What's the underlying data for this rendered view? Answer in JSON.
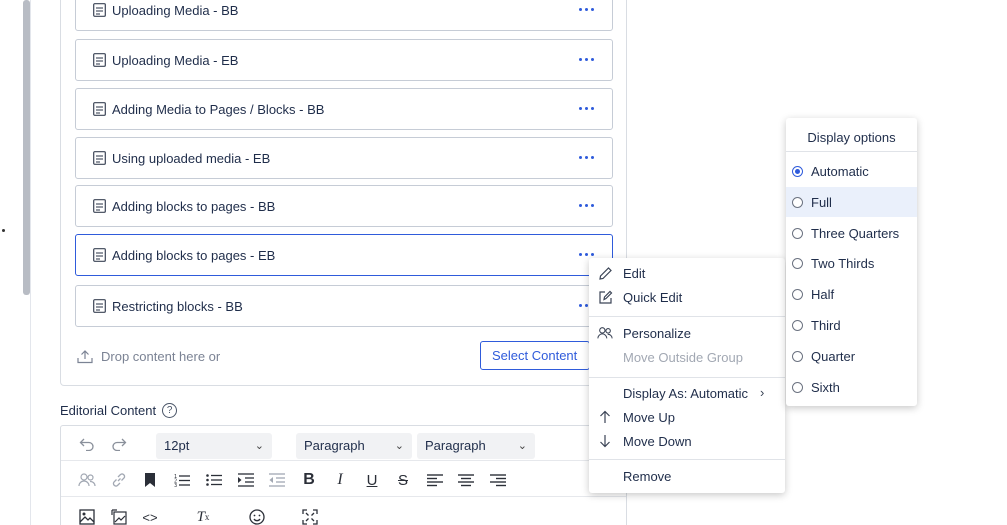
{
  "blocks": [
    {
      "label": "Uploading Media - BB"
    },
    {
      "label": "Uploading Media - EB"
    },
    {
      "label": "Adding Media to Pages / Blocks - BB"
    },
    {
      "label": "Using uploaded media - EB"
    },
    {
      "label": "Adding blocks to pages - BB"
    },
    {
      "label": "Adding blocks to pages - EB"
    },
    {
      "label": "Restricting blocks - BB"
    }
  ],
  "content_area": {
    "drop_text": "Drop content here or",
    "select_button": "Select Content"
  },
  "editorial": {
    "label": "Editorial Content",
    "help_icon": "?",
    "font_size": "12pt",
    "format1": "Paragraph",
    "format2": "Paragraph"
  },
  "context_menu": {
    "edit": "Edit",
    "quick_edit": "Quick Edit",
    "personalize": "Personalize",
    "move_outside_group": "Move Outside Group",
    "display_as": "Display As: Automatic",
    "move_up": "Move Up",
    "move_down": "Move Down",
    "remove": "Remove"
  },
  "display_options": {
    "header": "Display options",
    "options": [
      "Automatic",
      "Full",
      "Three Quarters",
      "Two Thirds",
      "Half",
      "Third",
      "Quarter",
      "Sixth"
    ],
    "selected": "Automatic",
    "hovered": "Full"
  },
  "colors": {
    "accent": "#2f5bdb",
    "text": "#1f2d4a",
    "disabled": "#a2a8b3",
    "hover": "#eaf0fb"
  }
}
